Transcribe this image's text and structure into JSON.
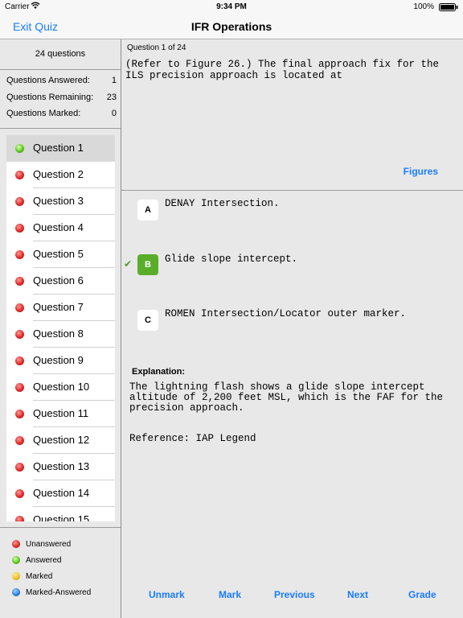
{
  "status": {
    "carrier": "Carrier",
    "time": "9:34 PM",
    "battery": "100%"
  },
  "nav": {
    "exit_label": "Exit Quiz",
    "title": "IFR Operations"
  },
  "sidebar": {
    "count": "24 questions",
    "stats": [
      {
        "label": "Questions Answered:",
        "value": "1"
      },
      {
        "label": "Questions Remaining:",
        "value": "23"
      },
      {
        "label": "Questions Marked:",
        "value": "0"
      }
    ],
    "questions": [
      {
        "label": "Question 1",
        "status": "green"
      },
      {
        "label": "Question 2",
        "status": "red"
      },
      {
        "label": "Question 3",
        "status": "red"
      },
      {
        "label": "Question 4",
        "status": "red"
      },
      {
        "label": "Question 5",
        "status": "red"
      },
      {
        "label": "Question 6",
        "status": "red"
      },
      {
        "label": "Question 7",
        "status": "red"
      },
      {
        "label": "Question 8",
        "status": "red"
      },
      {
        "label": "Question 9",
        "status": "red"
      },
      {
        "label": "Question 10",
        "status": "red"
      },
      {
        "label": "Question 11",
        "status": "red"
      },
      {
        "label": "Question 12",
        "status": "red"
      },
      {
        "label": "Question 13",
        "status": "red"
      },
      {
        "label": "Question 14",
        "status": "red"
      },
      {
        "label": "Question 15",
        "status": "red"
      }
    ],
    "legend": [
      {
        "label": "Unanswered",
        "color": "red"
      },
      {
        "label": "Answered",
        "color": "green"
      },
      {
        "label": "Marked",
        "color": "yellow"
      },
      {
        "label": "Marked-Answered",
        "color": "blue"
      }
    ]
  },
  "question": {
    "number": "Question 1 of 24",
    "text": "(Refer to Figure 26.) The final approach fix for the\nILS precision approach is located at",
    "figures_label": "Figures"
  },
  "answers": [
    {
      "letter": "A",
      "text": "DENAY Intersection."
    },
    {
      "letter": "B",
      "text": "Glide slope intercept.",
      "correct": true
    },
    {
      "letter": "C",
      "text": "ROMEN Intersection/Locator outer marker."
    }
  ],
  "explanation": {
    "title": "Explanation:",
    "text": "The lightning flash shows a glide slope intercept\naltitude of 2,200 feet MSL, which is the FAF for the\nprecision approach.",
    "reference": "Reference: IAP Legend"
  },
  "toolbar": {
    "unmark": "Unmark",
    "mark": "Mark",
    "previous": "Previous",
    "next": "Next",
    "grade": "Grade"
  },
  "colors": {
    "accent": "#1a7cff",
    "correct": "#5aad2a"
  }
}
